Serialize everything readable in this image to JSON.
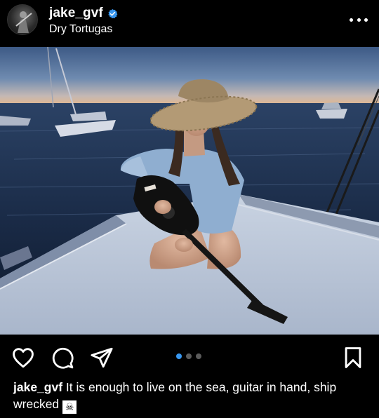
{
  "post": {
    "username": "jake_gvf",
    "location": "Dry Tortugas",
    "verified": true,
    "caption_user": "jake_gvf",
    "caption_text": "It is enough to live on the sea, guitar in hand, ship wrecked",
    "caption_emoji": "☠",
    "carousel": {
      "count": 3,
      "active_index": 1
    }
  },
  "icons": {
    "like": "heart-icon",
    "comment": "comment-icon",
    "share": "send-icon",
    "save": "bookmark-icon",
    "more": "more-options-icon",
    "verified": "verified-badge-icon"
  },
  "colors": {
    "background": "#000000",
    "accent": "#3897f0",
    "verified": "#3897f0"
  }
}
